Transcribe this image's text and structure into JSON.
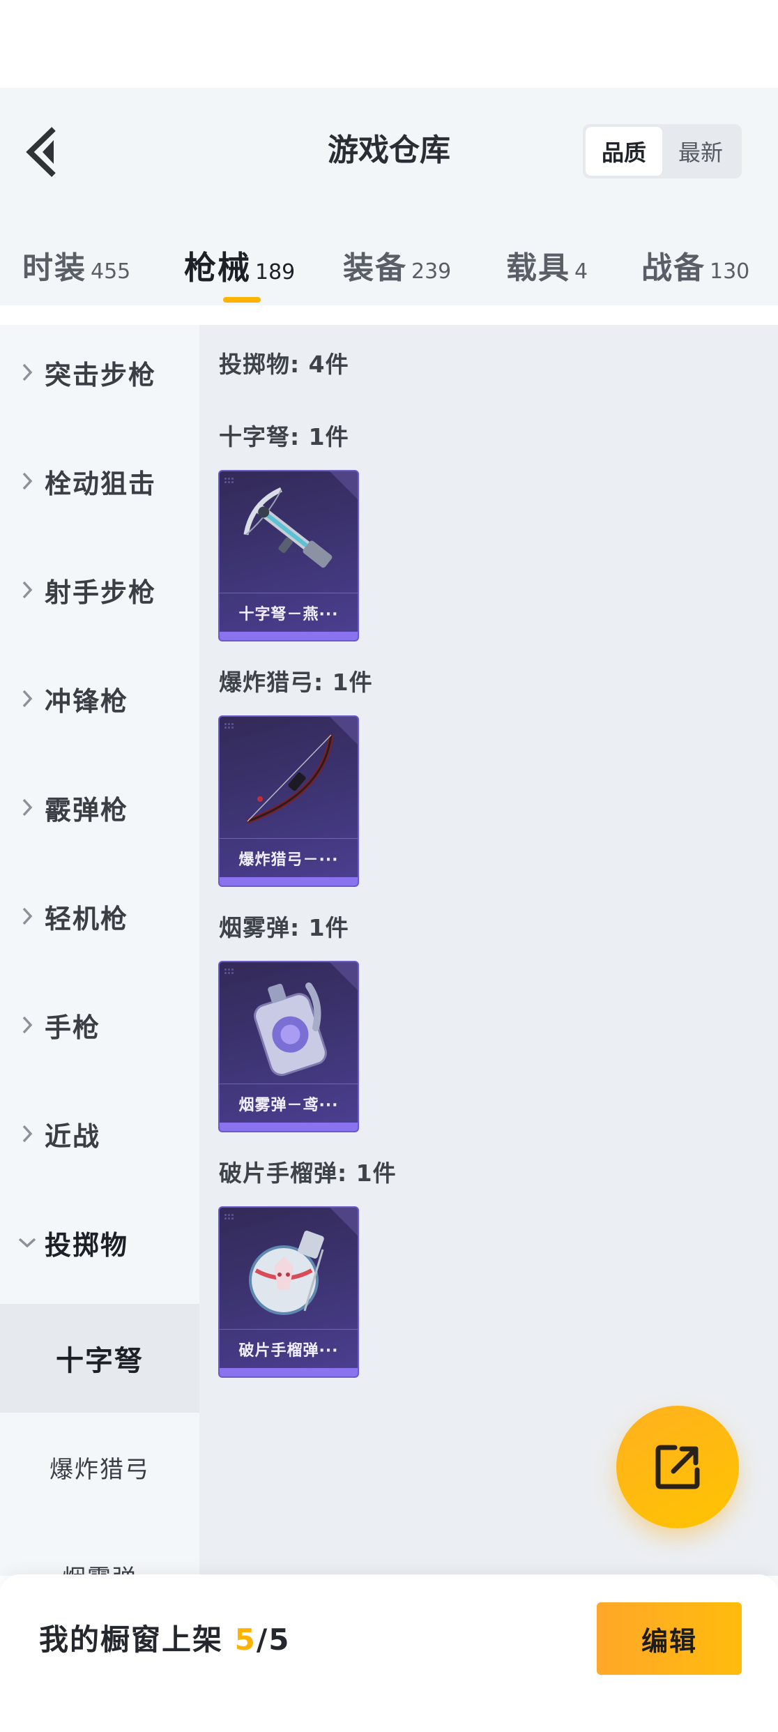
{
  "header": {
    "title": "游戏仓库",
    "sort_options": [
      "品质",
      "最新"
    ],
    "sort_selected": "品质"
  },
  "tabs": [
    {
      "name": "时装",
      "count": "455"
    },
    {
      "name": "枪械",
      "count": "189",
      "active": true
    },
    {
      "name": "装备",
      "count": "239"
    },
    {
      "name": "载具",
      "count": "4"
    },
    {
      "name": "战备",
      "count": "130"
    }
  ],
  "sidebar": {
    "categories": [
      "突击步枪",
      "栓动狙击",
      "射手步枪",
      "冲锋枪",
      "霰弹枪",
      "轻机枪",
      "手枪",
      "近战",
      "投掷物"
    ],
    "expanded": "投掷物",
    "subcategories": [
      "十字弩",
      "爆炸猎弓",
      "烟雾弹"
    ],
    "selected_sub": "十字弩"
  },
  "content": {
    "group_title": "投掷物: 4件",
    "sections": [
      {
        "title": "十字弩: 1件",
        "item": "十字弩－燕···",
        "icon": "crossbow-icon"
      },
      {
        "title": "爆炸猎弓: 1件",
        "item": "爆炸猎弓－···",
        "icon": "bow-icon"
      },
      {
        "title": "烟雾弹: 1件",
        "item": "烟雾弹－鸢···",
        "icon": "smoke-grenade-icon"
      },
      {
        "title": "破片手榴弹: 1件",
        "item": "破片手榴弹···",
        "icon": "frag-grenade-icon"
      }
    ]
  },
  "bottom": {
    "showcase_label": "我的橱窗上架",
    "showcase_current": "5",
    "showcase_total": "/5",
    "edit_label": "编辑"
  },
  "colors": {
    "accent": "#ffb300",
    "card_bg": "#3c3370",
    "card_border": "#6a5acb"
  }
}
